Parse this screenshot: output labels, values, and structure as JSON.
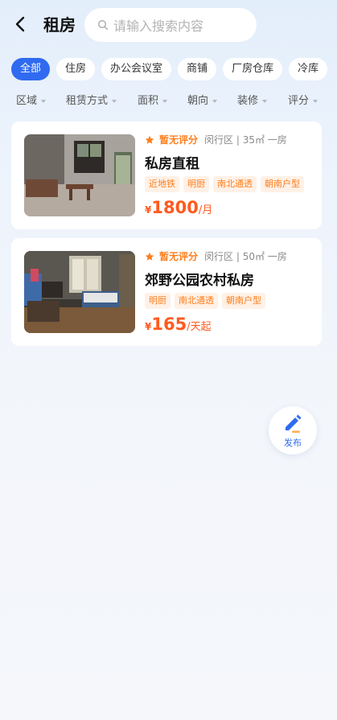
{
  "header": {
    "title": "租房",
    "search_placeholder": "请输入搜索内容"
  },
  "categories": [
    {
      "label": "全部",
      "active": true
    },
    {
      "label": "住房",
      "active": false
    },
    {
      "label": "办公会议室",
      "active": false
    },
    {
      "label": "商铺",
      "active": false
    },
    {
      "label": "厂房仓库",
      "active": false
    },
    {
      "label": "冷库",
      "active": false
    }
  ],
  "filters": [
    "区域",
    "租赁方式",
    "面积",
    "朝向",
    "装修",
    "评分"
  ],
  "listings": [
    {
      "rating": "暂无评分",
      "meta": "闵行区 | 35㎡ 一房",
      "title": "私房直租",
      "tags": [
        "近地铁",
        "明厨",
        "南北通透",
        "朝南户型"
      ],
      "currency": "¥",
      "price": "1800",
      "unit": "/月"
    },
    {
      "rating": "暂无评分",
      "meta": "闵行区 | 50㎡ 一房",
      "title": "郊野公园农村私房",
      "tags": [
        "明厨",
        "南北通透",
        "朝南户型"
      ],
      "currency": "¥",
      "price": "165",
      "unit": "/天起"
    }
  ],
  "fab": {
    "label": "发布"
  },
  "colors": {
    "accent": "#2f6af0",
    "price": "#ff5a1f",
    "rating": "#ff7d1a",
    "tag_bg": "#fff1e6"
  },
  "icons": [
    "back-arrow-icon",
    "search-icon",
    "star-icon",
    "edit-pen-icon"
  ]
}
